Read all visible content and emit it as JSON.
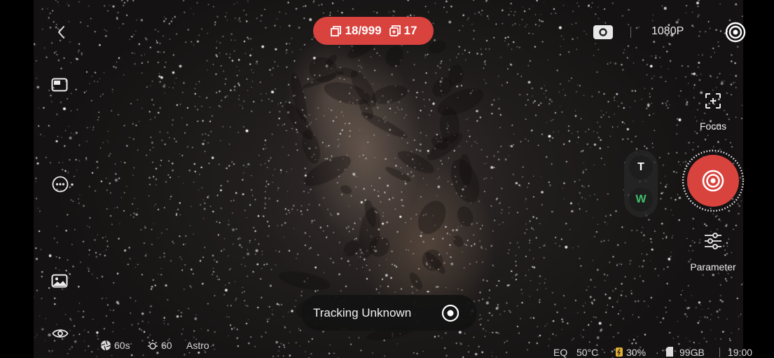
{
  "top": {
    "frames_count": "18/999",
    "stack_count": "17",
    "resolution": "1080P"
  },
  "right": {
    "focus_label": "Focus",
    "parameter_label": "Parameter",
    "zoom_tele": "T",
    "zoom_wide": "W"
  },
  "tracking": {
    "status": "Tracking Unknown"
  },
  "bottom_left": {
    "exposure": "60s",
    "gain": "60",
    "mode": "Astro"
  },
  "bottom_right": {
    "mount_mode": "EQ",
    "temperature": "50°C",
    "battery": "30%",
    "storage": "99GB",
    "time": "19:00"
  },
  "colors": {
    "accent_red": "#d9433e",
    "wide_green": "#3fbf6a"
  },
  "icons": [
    "back-icon",
    "picture-in-picture-icon",
    "more-icon",
    "gallery-icon",
    "eye-icon",
    "stack-frames-icon",
    "stack-copy-icon",
    "camera-mode-icon",
    "target-icon",
    "focus-icon",
    "shutter-icon",
    "parameter-sliders-icon",
    "record-stop-icon",
    "aperture-icon",
    "brightness-icon",
    "battery-icon",
    "sd-card-icon"
  ]
}
